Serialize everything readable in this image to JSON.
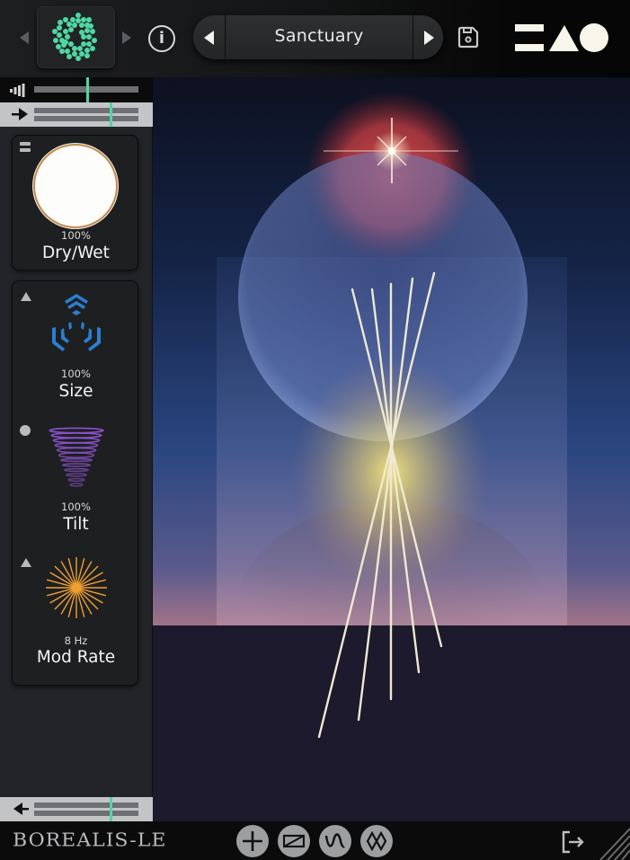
{
  "header": {
    "preset_logo_prev_icon": "triangle-left-icon",
    "preset_logo_icon": "dotted-ring-logo-icon",
    "preset_logo_next_icon": "triangle-right-icon",
    "info_icon": "info-icon",
    "info_label": "i",
    "preset": {
      "prev_icon": "triangle-left-icon",
      "name": "Sanctuary",
      "next_icon": "triangle-right-icon"
    },
    "save_icon": "floppy-disk-icon",
    "brand_icon": "bars-triangle-circle-logo-icon",
    "accent_color": "#4fd7a4"
  },
  "sidebar": {
    "input_meter": {
      "icon": "signal-bars-icon",
      "level": 0.5
    },
    "input_route": {
      "icon": "arrow-right-icon",
      "level": 0.72
    },
    "output_route": {
      "icon": "arrow-left-icon",
      "level": 0.72
    },
    "drywet": {
      "menu_icon": "menu-icon",
      "value": "100%",
      "label": "Dry/Wet",
      "amount": 1.0,
      "ring_color": "#c38a4c"
    },
    "params": [
      {
        "mode_icon": "triangle-up-icon",
        "icon": "size-chevrons-icon",
        "value": "100%",
        "label": "Size",
        "color": "#2a7fd0"
      },
      {
        "mode_icon": "dot-icon",
        "icon": "tilt-funnel-icon",
        "value": "100%",
        "label": "Tilt",
        "color": "#8a52c8"
      },
      {
        "mode_icon": "triangle-up-icon",
        "icon": "mod-rate-starburst-icon",
        "value": "8 Hz",
        "label": "Mod Rate",
        "color": "#f0a030"
      }
    ],
    "collapse_icon": "triangle-left-icon"
  },
  "artwork": {
    "description": "sphere-with-star-and-light-rays",
    "colors": {
      "sky_top": "#0e1428",
      "sky_mid": "#2c4a86",
      "horizon": "#e8a27a",
      "ground": "#1c1a2c",
      "glow": "#f1e27a",
      "orb": "#c84a4a"
    }
  },
  "footer": {
    "brand_name": "BOREALIS-LE",
    "mod_buttons": [
      {
        "icon": "plus-icon",
        "name": "add"
      },
      {
        "icon": "ramp-icon",
        "name": "ramp"
      },
      {
        "icon": "sine-wave-icon",
        "name": "wave"
      },
      {
        "icon": "diamond-shape-icon",
        "name": "shape"
      }
    ],
    "exit_icon": "exit-icon",
    "resize_icon": "resize-grip-icon"
  }
}
